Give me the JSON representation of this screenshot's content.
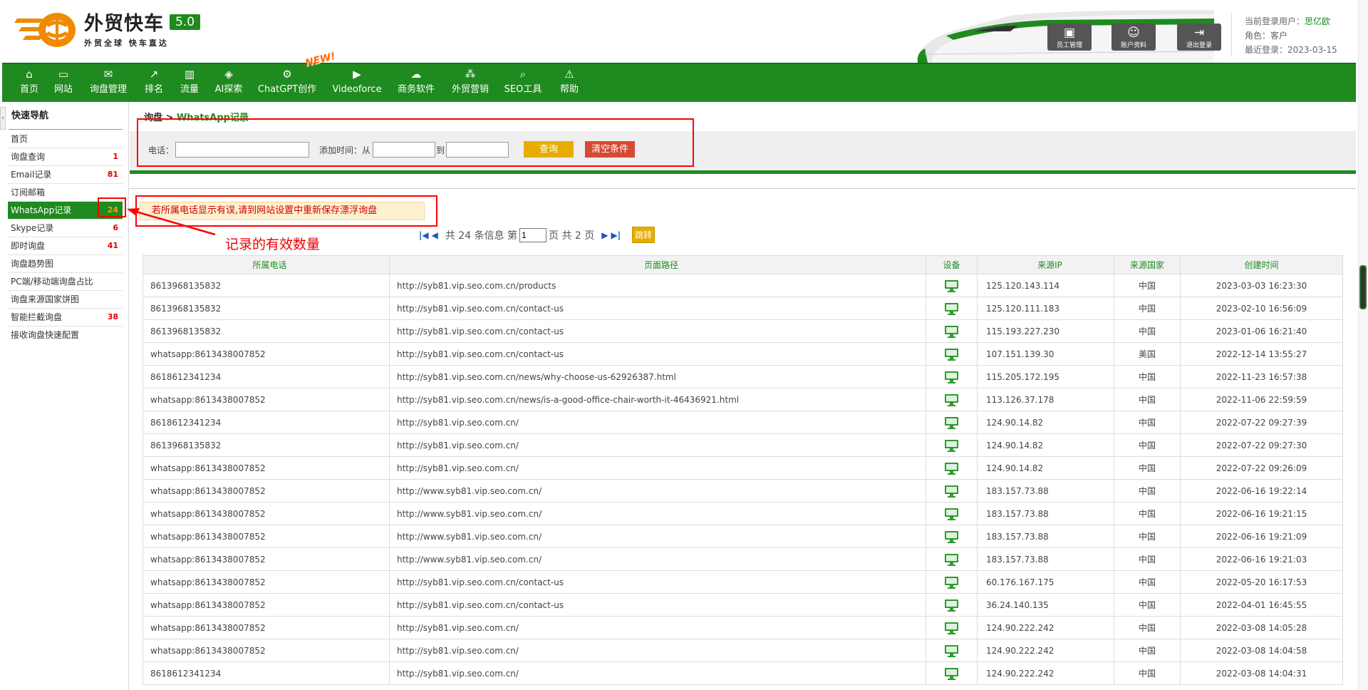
{
  "header": {
    "logo_title": "外贸快车",
    "logo_version": "5.0",
    "logo_slogan": "外贸全球 快车直达",
    "buttons": [
      {
        "label": "员工管理",
        "icon": "staff-icon"
      },
      {
        "label": "账户资料",
        "icon": "account-icon"
      },
      {
        "label": "退出登录",
        "icon": "logout-icon"
      }
    ],
    "user": {
      "current_label": "当前登录用户：",
      "current_user": "思亿欧",
      "role_label": "角色：",
      "role": "客户",
      "last_login_label": "最近登录：",
      "last_login": "2023-03-15"
    }
  },
  "nav": {
    "new_badge": "NEW!",
    "items": [
      {
        "label": "首页",
        "icon": "⌂"
      },
      {
        "label": "网站",
        "icon": "▭"
      },
      {
        "label": "询盘管理",
        "icon": "✉"
      },
      {
        "label": "排名",
        "icon": "↗"
      },
      {
        "label": "流量",
        "icon": "▥"
      },
      {
        "label": "AI探索",
        "icon": "◈"
      },
      {
        "label": "ChatGPT创作",
        "icon": "⚙"
      },
      {
        "label": "Videoforce",
        "icon": "▶"
      },
      {
        "label": "商务软件",
        "icon": "☁"
      },
      {
        "label": "外贸营销",
        "icon": "⁂"
      },
      {
        "label": "SEO工具",
        "icon": "⌕"
      },
      {
        "label": "帮助",
        "icon": "⚠"
      }
    ]
  },
  "sidebar": {
    "toggle": "‹",
    "title": "快速导航",
    "items": [
      {
        "label": "首页",
        "count": ""
      },
      {
        "label": "询盘查询",
        "count": "1"
      },
      {
        "label": "Email记录",
        "count": "81"
      },
      {
        "label": "订阅邮箱",
        "count": ""
      },
      {
        "label": "WhatsApp记录",
        "count": "24"
      },
      {
        "label": "Skype记录",
        "count": "6"
      },
      {
        "label": "即时询盘",
        "count": "41"
      },
      {
        "label": "询盘趋势图",
        "count": ""
      },
      {
        "label": "PC端/移动端询盘占比",
        "count": ""
      },
      {
        "label": "询盘来源国家饼图",
        "count": ""
      },
      {
        "label": "智能拦截询盘",
        "count": "38"
      },
      {
        "label": "接收询盘快速配置",
        "count": ""
      }
    ]
  },
  "breadcrumb": {
    "parent": "询盘",
    "separator": " > ",
    "current": "WhatsApp记录"
  },
  "search": {
    "phone_label": "电话：",
    "phone_value": "",
    "time_label": "添加时间：从",
    "from_value": "",
    "to_label": "到",
    "to_value": "",
    "query_button": "查询",
    "clear_button": "清空条件"
  },
  "notice": "若所属电话显示有误,请到网站设置中重新保存漂浮询盘",
  "annotation": "记录的有效数量",
  "pager": {
    "total_text": "共 24 条信息 第",
    "page_value": "1",
    "pages_text": "页 共 2 页",
    "jump_button": "跳转"
  },
  "table": {
    "headers": [
      "所属电话",
      "页面路径",
      "设备",
      "来源IP",
      "来源国家",
      "创建时间"
    ],
    "rows": [
      [
        "8613968135832",
        "http://syb81.vip.seo.com.cn/products",
        "pc",
        "125.120.143.114",
        "中国",
        "2023-03-03 16:23:30"
      ],
      [
        "8613968135832",
        "http://syb81.vip.seo.com.cn/contact-us",
        "pc",
        "125.120.111.183",
        "中国",
        "2023-02-10 16:56:09"
      ],
      [
        "8613968135832",
        "http://syb81.vip.seo.com.cn/contact-us",
        "pc",
        "115.193.227.230",
        "中国",
        "2023-01-06 16:21:40"
      ],
      [
        "whatsapp:8613438007852",
        "http://syb81.vip.seo.com.cn/contact-us",
        "pc",
        "107.151.139.30",
        "美国",
        "2022-12-14 13:55:27"
      ],
      [
        "8618612341234",
        "http://syb81.vip.seo.com.cn/news/why-choose-us-62926387.html",
        "pc",
        "115.205.172.195",
        "中国",
        "2022-11-23 16:57:38"
      ],
      [
        "whatsapp:8613438007852",
        "http://syb81.vip.seo.com.cn/news/is-a-good-office-chair-worth-it-46436921.html",
        "pc",
        "113.126.37.178",
        "中国",
        "2022-11-06 22:59:59"
      ],
      [
        "8618612341234",
        "http://syb81.vip.seo.com.cn/",
        "pc",
        "124.90.14.82",
        "中国",
        "2022-07-22 09:27:39"
      ],
      [
        "8613968135832",
        "http://syb81.vip.seo.com.cn/",
        "pc",
        "124.90.14.82",
        "中国",
        "2022-07-22 09:27:30"
      ],
      [
        "whatsapp:8613438007852",
        "http://syb81.vip.seo.com.cn/",
        "pc",
        "124.90.14.82",
        "中国",
        "2022-07-22 09:26:09"
      ],
      [
        "whatsapp:8613438007852",
        "http://www.syb81.vip.seo.com.cn/",
        "pc",
        "183.157.73.88",
        "中国",
        "2022-06-16 19:22:14"
      ],
      [
        "whatsapp:8613438007852",
        "http://www.syb81.vip.seo.com.cn/",
        "pc",
        "183.157.73.88",
        "中国",
        "2022-06-16 19:21:15"
      ],
      [
        "whatsapp:8613438007852",
        "http://www.syb81.vip.seo.com.cn/",
        "pc",
        "183.157.73.88",
        "中国",
        "2022-06-16 19:21:09"
      ],
      [
        "whatsapp:8613438007852",
        "http://www.syb81.vip.seo.com.cn/",
        "pc",
        "183.157.73.88",
        "中国",
        "2022-06-16 19:21:03"
      ],
      [
        "whatsapp:8613438007852",
        "http://syb81.vip.seo.com.cn/contact-us",
        "pc",
        "60.176.167.175",
        "中国",
        "2022-05-20 16:17:53"
      ],
      [
        "whatsapp:8613438007852",
        "http://syb81.vip.seo.com.cn/contact-us",
        "pc",
        "36.24.140.135",
        "中国",
        "2022-04-01 16:45:55"
      ],
      [
        "whatsapp:8613438007852",
        "http://syb81.vip.seo.com.cn/",
        "pc",
        "124.90.222.242",
        "中国",
        "2022-03-08 14:05:28"
      ],
      [
        "whatsapp:8613438007852",
        "http://syb81.vip.seo.com.cn/",
        "pc",
        "124.90.222.242",
        "中国",
        "2022-03-08 14:04:58"
      ],
      [
        "8618612341234",
        "http://syb81.vip.seo.com.cn/",
        "pc",
        "124.90.222.242",
        "中国",
        "2022-03-08 14:04:31"
      ]
    ]
  },
  "colors": {
    "brand_green": "#1f8a1f",
    "accent_orange": "#f08a00",
    "query_yellow": "#e6ad00",
    "clear_red": "#d44a33",
    "annotation_red": "#ff0000"
  }
}
